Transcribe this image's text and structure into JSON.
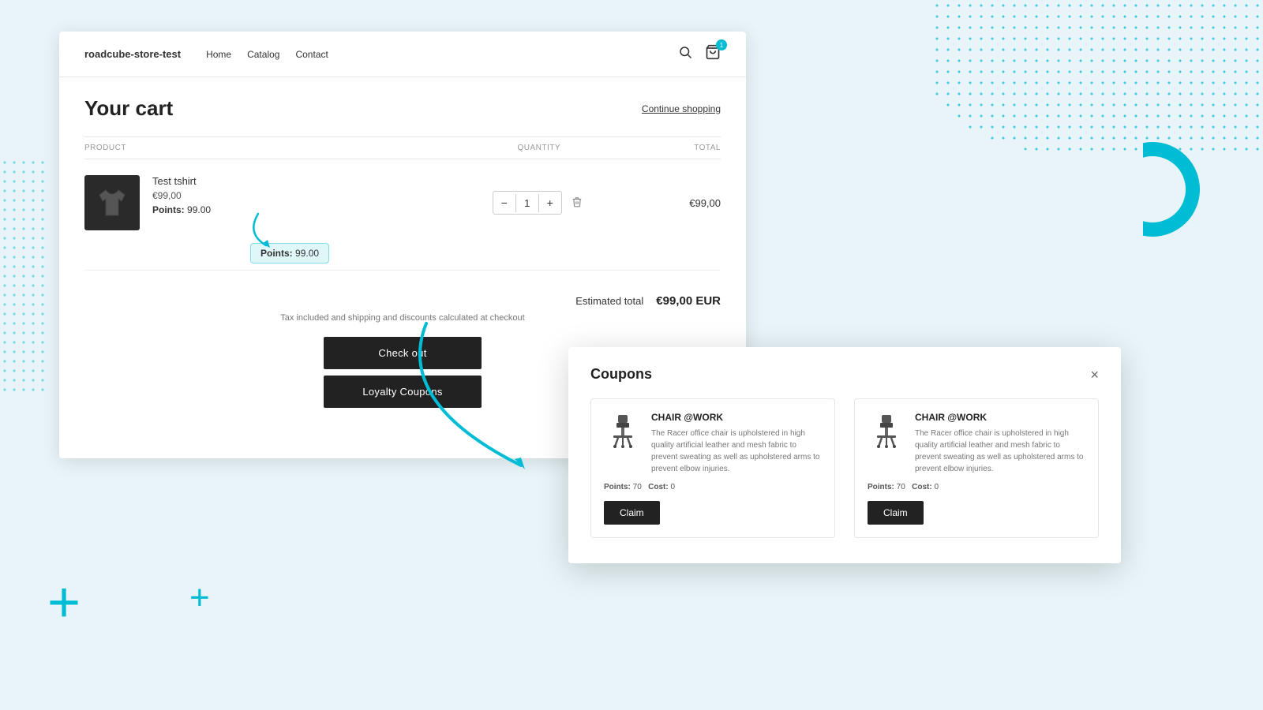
{
  "background": {
    "accent_color": "#00bcd4"
  },
  "store": {
    "name": "roadcube-store-test",
    "nav": [
      {
        "label": "Home"
      },
      {
        "label": "Catalog"
      },
      {
        "label": "Contact"
      }
    ]
  },
  "cart": {
    "title": "Your cart",
    "continue_shopping": "Continue shopping",
    "table_headers": {
      "product": "PRODUCT",
      "quantity": "QUANTITY",
      "total": "TOTAL"
    },
    "items": [
      {
        "name": "Test tshirt",
        "price": "€99,00",
        "points_label": "Points:",
        "points_value": "99.00",
        "quantity": "1",
        "total": "€99,00"
      }
    ],
    "points_tooltip": {
      "label": "Points:",
      "value": "99.00"
    },
    "estimated_total_label": "Estimated total",
    "estimated_total_value": "€99,00 EUR",
    "tax_note": "Tax included and shipping and discounts calculated at checkout",
    "checkout_btn": "Check out",
    "loyalty_btn": "Loyalty Coupons"
  },
  "coupons_modal": {
    "title": "Coupons",
    "close_label": "×",
    "items": [
      {
        "name": "CHAIR @WORK",
        "description": "The Racer office chair is upholstered in high quality artificial leather and mesh fabric to prevent sweating as well as upholstered arms to prevent elbow injuries.",
        "points_label": "Points:",
        "points_value": "70",
        "cost_label": "Cost:",
        "cost_value": "0",
        "claim_btn": "Claim"
      },
      {
        "name": "CHAIR @WORK",
        "description": "The Racer office chair is upholstered in high quality artificial leather and mesh fabric to prevent sweating as well as upholstered arms to prevent elbow injuries.",
        "points_label": "Points:",
        "points_value": "70",
        "cost_label": "Cost:",
        "cost_value": "0",
        "claim_btn": "Claim"
      }
    ]
  }
}
